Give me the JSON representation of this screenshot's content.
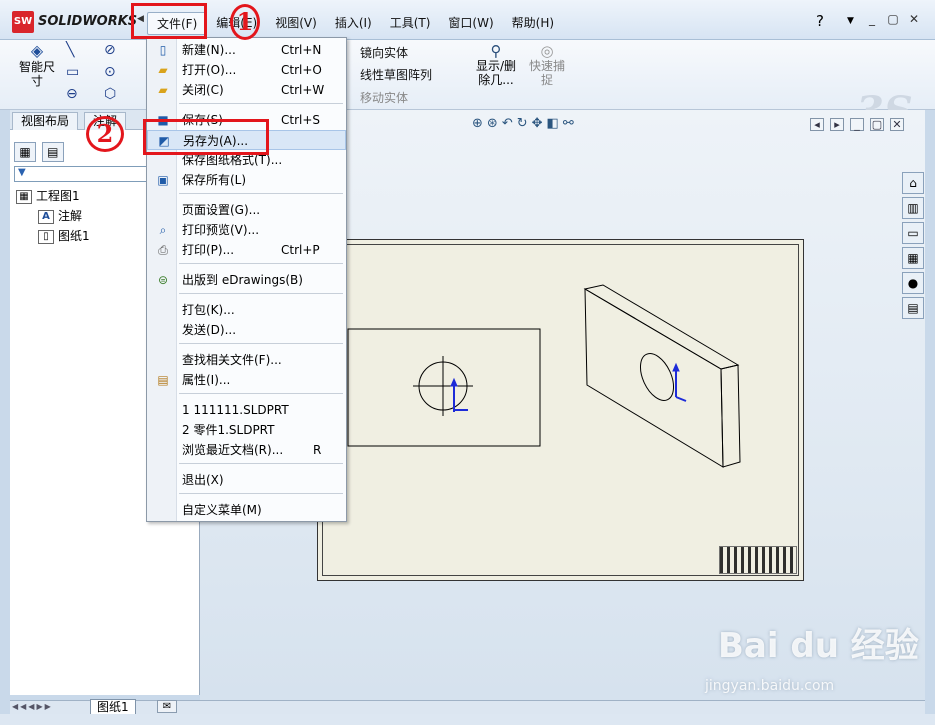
{
  "app": {
    "logo": "SW",
    "brand": "SOLIDWORKS"
  },
  "menubar": [
    {
      "label": "文件(F)"
    },
    {
      "label": "编辑(E)"
    },
    {
      "label": "视图(V)"
    },
    {
      "label": "插入(I)"
    },
    {
      "label": "工具(T)"
    },
    {
      "label": "窗口(W)"
    },
    {
      "label": "帮助(H)"
    }
  ],
  "ribbon": {
    "smart_dim": "智能尺寸",
    "mirror": "镜向实体",
    "linear_pattern": "线性草图阵列",
    "move": "移动实体",
    "show_delete": "显示/删除几...",
    "quick_snap": "快速捕捉"
  },
  "leftpanel": {
    "tabs": [
      "视图布局",
      "注解"
    ],
    "tree": {
      "root": "工程图1",
      "children": [
        "注解",
        "图纸1"
      ]
    }
  },
  "file_menu": {
    "items": [
      {
        "label": "新建(N)...",
        "shortcut": "Ctrl+N"
      },
      {
        "label": "打开(O)...",
        "shortcut": "Ctrl+O"
      },
      {
        "label": "关闭(C)",
        "shortcut": "Ctrl+W"
      },
      {
        "label": "保存(S)",
        "shortcut": "Ctrl+S"
      },
      {
        "label": "另存为(A)...",
        "shortcut": ""
      },
      {
        "label": "保存图纸格式(T)...",
        "shortcut": ""
      },
      {
        "label": "保存所有(L)",
        "shortcut": ""
      },
      {
        "label": "页面设置(G)...",
        "shortcut": ""
      },
      {
        "label": "打印预览(V)...",
        "shortcut": ""
      },
      {
        "label": "打印(P)...",
        "shortcut": "Ctrl+P"
      },
      {
        "label": "出版到 eDrawings(B)",
        "shortcut": ""
      },
      {
        "label": "打包(K)...",
        "shortcut": ""
      },
      {
        "label": "发送(D)...",
        "shortcut": ""
      },
      {
        "label": "查找相关文件(F)...",
        "shortcut": ""
      },
      {
        "label": "属性(I)...",
        "shortcut": ""
      },
      {
        "label": "1 111111.SLDPRT",
        "shortcut": ""
      },
      {
        "label": "2 零件1.SLDPRT",
        "shortcut": ""
      },
      {
        "label": "浏览最近文档(R)...",
        "shortcut": "R"
      },
      {
        "label": "退出(X)",
        "shortcut": ""
      },
      {
        "label": "自定义菜单(M)",
        "shortcut": ""
      }
    ]
  },
  "sheet_tab": "图纸1",
  "annotations": {
    "step1": "1",
    "step2": "2"
  },
  "watermark": {
    "main": "Bai du 经验",
    "sub": "jingyan.baidu.com"
  },
  "colors": {
    "annotation_red": "#e3161c",
    "menu_highlight": "#d9e7f7",
    "sheet_bg": "#f0efe2"
  }
}
